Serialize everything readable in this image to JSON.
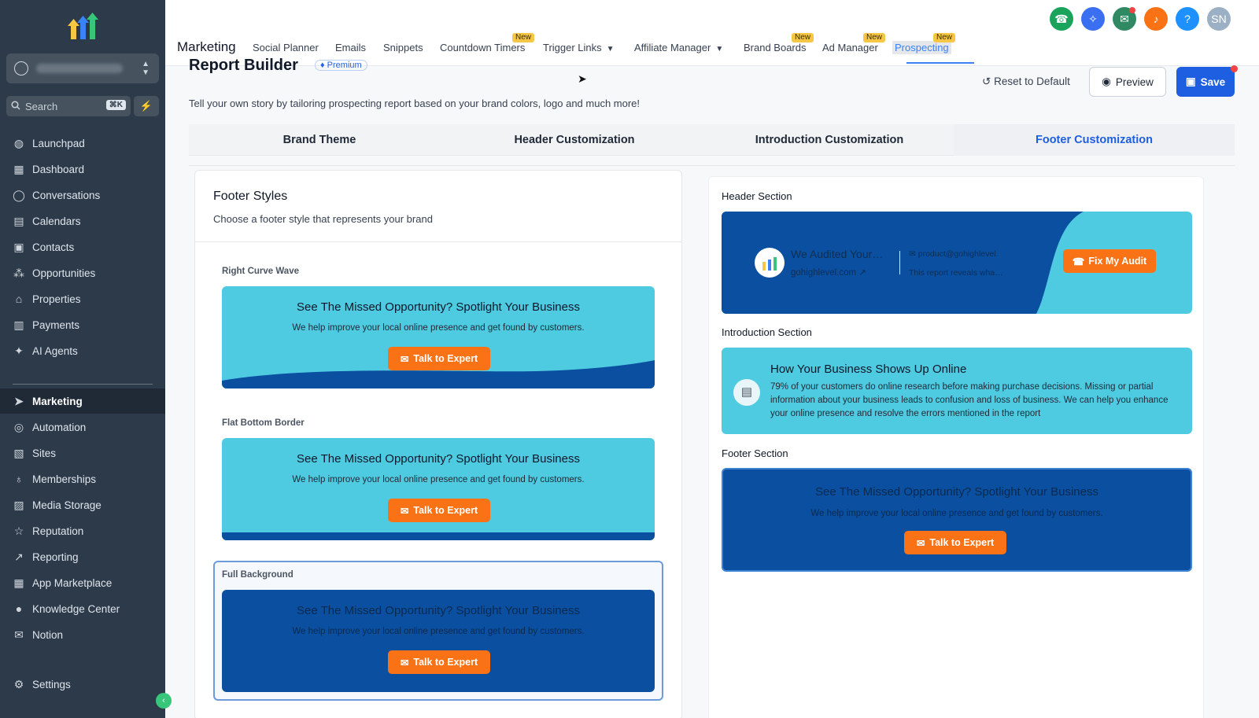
{
  "sidebar": {
    "search": {
      "placeholder": "Search",
      "shortcut": "⌘K"
    },
    "items": [
      {
        "label": "Launchpad",
        "icon": "rocket-icon"
      },
      {
        "label": "Dashboard",
        "icon": "grid-icon"
      },
      {
        "label": "Conversations",
        "icon": "chat-icon"
      },
      {
        "label": "Calendars",
        "icon": "calendar-icon"
      },
      {
        "label": "Contacts",
        "icon": "contacts-icon"
      },
      {
        "label": "Opportunities",
        "icon": "funnel-icon"
      },
      {
        "label": "Properties",
        "icon": "home-icon"
      },
      {
        "label": "Payments",
        "icon": "receipt-icon"
      },
      {
        "label": "AI Agents",
        "icon": "sparkle-icon"
      },
      {
        "label": "Marketing",
        "icon": "send-icon"
      },
      {
        "label": "Automation",
        "icon": "automation-icon"
      },
      {
        "label": "Sites",
        "icon": "sites-icon"
      },
      {
        "label": "Memberships",
        "icon": "memberships-icon"
      },
      {
        "label": "Media Storage",
        "icon": "image-icon"
      },
      {
        "label": "Reputation",
        "icon": "star-icon"
      },
      {
        "label": "Reporting",
        "icon": "trend-icon"
      },
      {
        "label": "App Marketplace",
        "icon": "apps-icon"
      },
      {
        "label": "Knowledge Center",
        "icon": "info-icon"
      },
      {
        "label": "Notion",
        "icon": "mail-icon"
      },
      {
        "label": "Settings",
        "icon": "gear-icon"
      }
    ]
  },
  "topbar": {
    "section": "Marketing",
    "tabs": [
      {
        "label": "Social Planner"
      },
      {
        "label": "Emails"
      },
      {
        "label": "Snippets"
      },
      {
        "label": "Countdown Timers",
        "badge": "New"
      },
      {
        "label": "Trigger Links"
      },
      {
        "label": "Affiliate Manager"
      },
      {
        "label": "Brand Boards",
        "badge": "New"
      },
      {
        "label": "Ad Manager",
        "badge": "New"
      },
      {
        "label": "Prospecting",
        "badge": "New"
      }
    ],
    "avatar": "SN",
    "help": "?"
  },
  "page": {
    "title": "Report Builder",
    "premium": "♦ Premium",
    "description": "Tell your own story by tailoring prospecting report based on your brand colors, logo and much more!",
    "reset": "Reset to Default",
    "preview": "Preview",
    "save": "Save",
    "tabs": [
      "Brand Theme",
      "Header Customization",
      "Introduction Customization",
      "Footer Customization"
    ]
  },
  "footer_styles": {
    "title": "Footer Styles",
    "subtitle": "Choose a footer style that represents your brand",
    "styles": [
      {
        "name": "Right Curve Wave"
      },
      {
        "name": "Flat Bottom Border"
      },
      {
        "name": "Full Background"
      }
    ],
    "card_title": "See The Missed Opportunity? Spotlight Your Business",
    "card_sub": "We help improve your local online presence and get found by customers.",
    "cta": "Talk to Expert"
  },
  "preview": {
    "header_label": "Header Section",
    "header_title": "We Audited Your…",
    "header_url": "gohighlevel.com",
    "header_email": "product@gohighlevel.",
    "header_report": "This report reveals wha…",
    "header_cta": "Fix My Audit",
    "intro_label": "Introduction Section",
    "intro_title": "How Your Business Shows Up Online",
    "intro_text": "79% of your customers do online research before making purchase decisions. Missing or partial information about your business leads to confusion and loss of business. We can help you enhance your online presence and resolve the errors mentioned in the report",
    "footer_label": "Footer Section"
  },
  "colors": {
    "sidebar": "#2d3a4a",
    "accent": "#1d5fe0",
    "cyan": "#4ecbe0",
    "navy": "#0a4fa0",
    "cta": "#f97316"
  }
}
